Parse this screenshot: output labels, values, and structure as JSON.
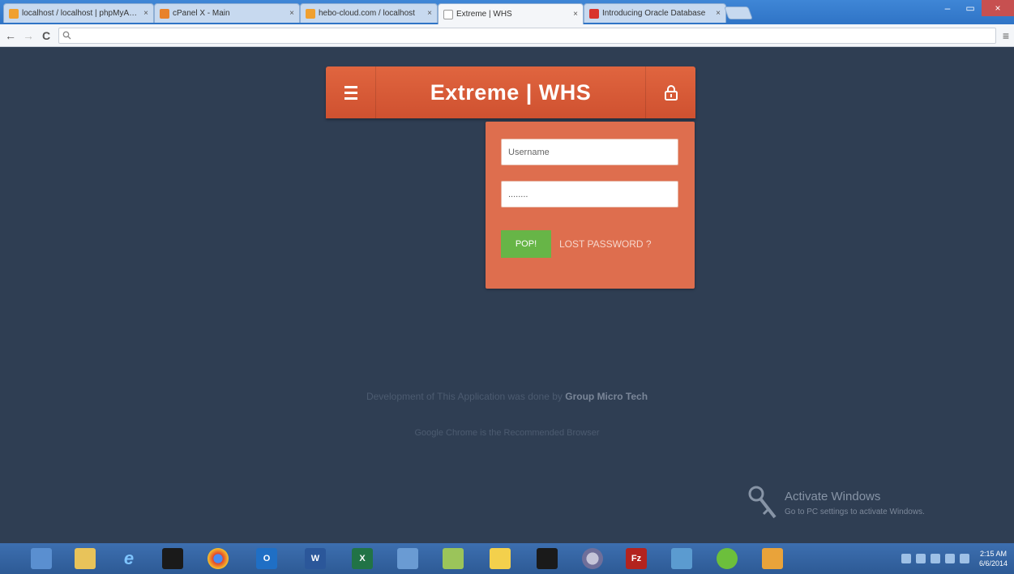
{
  "browser": {
    "tabs": [
      {
        "label": "localhost / localhost | phpMyAdmin",
        "favicon_color": "#f0a030",
        "active": false
      },
      {
        "label": "cPanel X - Main",
        "favicon_color": "#e8822b",
        "active": false
      },
      {
        "label": "hebo-cloud.com / localhost",
        "favicon_color": "#f0a030",
        "active": false
      },
      {
        "label": "Extreme | WHS",
        "favicon_color": "#ffffff",
        "active": true
      },
      {
        "label": "Introducing Oracle Database",
        "favicon_color": "#d9332c",
        "active": false
      }
    ],
    "tab_close_glyph": "×",
    "window_buttons": {
      "minimize": "–",
      "maximize": "▭",
      "close": "×"
    },
    "nav": {
      "back": "←",
      "forward": "→",
      "reload": "C",
      "menu": "≡"
    },
    "omnibox": {
      "value": ""
    }
  },
  "app": {
    "title": "Extreme | WHS",
    "menu_icon": "hamburger-icon",
    "lock_icon": "lock-icon",
    "accent_color": "#d95a36",
    "panel_color": "#de6e4e"
  },
  "login": {
    "username_placeholder": "Username",
    "password_value": "........",
    "submit_label": "POP!",
    "lost_password_label": "LOST PASSWORD ?",
    "submit_color": "#67b547"
  },
  "footer": {
    "line1_prefix": "Development of This Application was done by",
    "line1_company": "Group Micro Tech",
    "line2": "Google Chrome is the Recommended Browser"
  },
  "activation": {
    "title": "Activate Windows",
    "subtitle": "Go to PC settings to activate Windows."
  },
  "taskbar": {
    "clock_time": "2:15 AM",
    "clock_date": "6/6/2014"
  }
}
